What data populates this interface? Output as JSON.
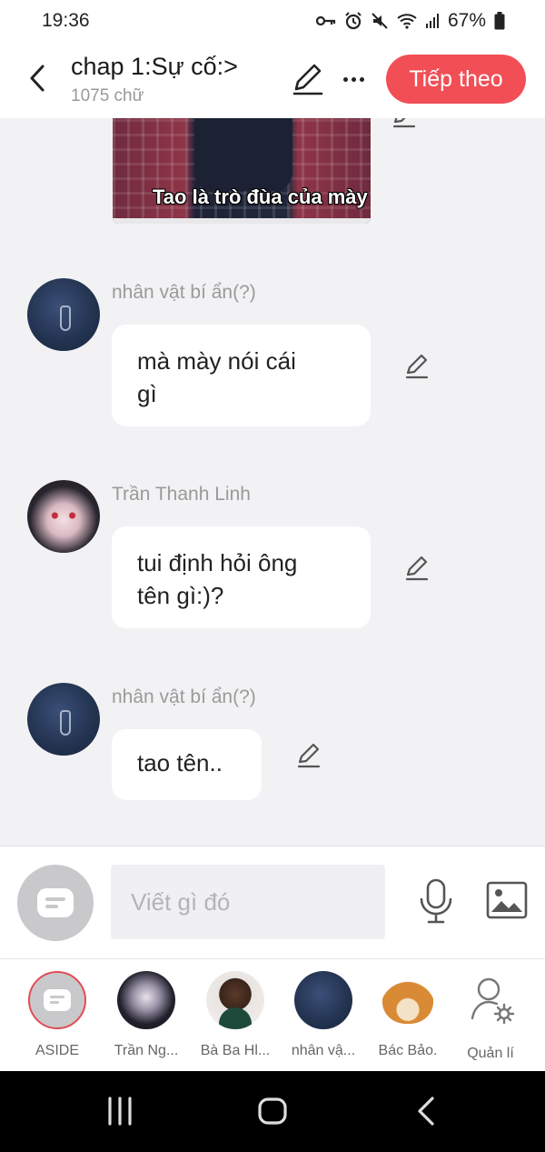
{
  "status_bar": {
    "time": "19:36",
    "battery": "67%"
  },
  "header": {
    "title": "chap 1:Sự cố:>",
    "word_count": "1075 chữ",
    "next_button": "Tiếp theo"
  },
  "image_message": {
    "caption": "Tao là trò đùa của mày"
  },
  "messages": [
    {
      "sender": "nhân vật bí ẩn(?)",
      "line1": "mà mày nói cái",
      "line2": "gì"
    },
    {
      "sender": "Trần Thanh Linh",
      "line1": "tui định hỏi ông",
      "line2": "tên gì:)?"
    },
    {
      "sender": "nhân vật bí ẩn(?)",
      "line1": "tao tên.."
    }
  ],
  "composer": {
    "placeholder": "Viết gì đó"
  },
  "characters": [
    {
      "label": "ASIDE"
    },
    {
      "label": "Trần Ng..."
    },
    {
      "label": "Bà Ba Hl..."
    },
    {
      "label": "nhân vậ..."
    },
    {
      "label": "Bác Bảo."
    },
    {
      "label": "Quản lí"
    }
  ],
  "icons": {
    "back": "chevron-left-icon",
    "edit": "pencil-icon",
    "more": "more-horizontal-icon",
    "mic": "microphone-icon",
    "image": "image-icon",
    "manage": "user-settings-icon"
  },
  "colors": {
    "accent": "#f24e56",
    "background": "#f2f2f4"
  }
}
